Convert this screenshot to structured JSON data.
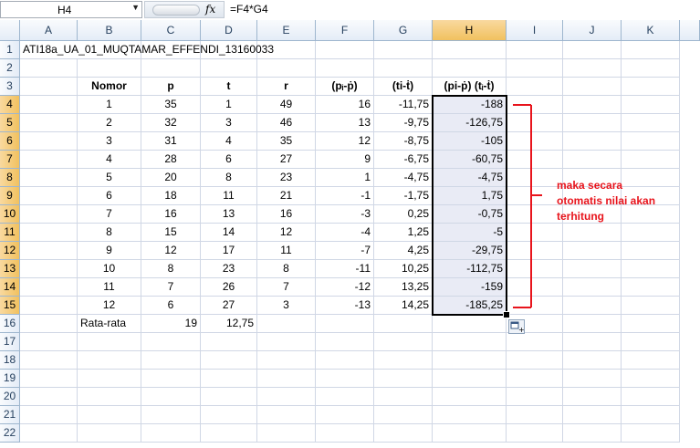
{
  "formula_bar": {
    "name_box": "H4",
    "fx_label": "fx",
    "formula": "=F4*G4"
  },
  "columns": [
    "A",
    "B",
    "C",
    "D",
    "E",
    "F",
    "G",
    "H",
    "I",
    "J",
    "K"
  ],
  "selected_column": "H",
  "rows": [
    "1",
    "2",
    "3",
    "4",
    "5",
    "6",
    "7",
    "8",
    "9",
    "10",
    "11",
    "12",
    "13",
    "14",
    "15",
    "16",
    "17",
    "18",
    "19",
    "20",
    "21",
    "22"
  ],
  "title": "ATI18a_UA_01_MUQTAMAR_EFFENDI_13160033",
  "headers": {
    "B": "Nomor",
    "C": "p",
    "D": "t",
    "E": "r",
    "F": "(pᵢ-ṗ)",
    "G": "(ti-ṫ)",
    "H": "(pi-ṗ) (tᵢ-ṫ)"
  },
  "table": [
    [
      "1",
      "35",
      "1",
      "49",
      "16",
      "-11,75",
      "-188"
    ],
    [
      "2",
      "32",
      "3",
      "46",
      "13",
      "-9,75",
      "-126,75"
    ],
    [
      "3",
      "31",
      "4",
      "35",
      "12",
      "-8,75",
      "-105"
    ],
    [
      "4",
      "28",
      "6",
      "27",
      "9",
      "-6,75",
      "-60,75"
    ],
    [
      "5",
      "20",
      "8",
      "23",
      "1",
      "-4,75",
      "-4,75"
    ],
    [
      "6",
      "18",
      "11",
      "21",
      "-1",
      "-1,75",
      "1,75"
    ],
    [
      "7",
      "16",
      "13",
      "16",
      "-3",
      "0,25",
      "-0,75"
    ],
    [
      "8",
      "15",
      "14",
      "12",
      "-4",
      "1,25",
      "-5"
    ],
    [
      "9",
      "12",
      "17",
      "11",
      "-7",
      "4,25",
      "-29,75"
    ],
    [
      "10",
      "8",
      "23",
      "8",
      "-11",
      "10,25",
      "-112,75"
    ],
    [
      "11",
      "7",
      "26",
      "7",
      "-12",
      "13,25",
      "-159"
    ],
    [
      "12",
      "6",
      "27",
      "3",
      "-13",
      "14,25",
      "-185,25"
    ]
  ],
  "average_row": {
    "label": "Rata-rata",
    "p_avg": "19",
    "t_avg": "12,75"
  },
  "annotation": {
    "text_lines": [
      "maka secara",
      "otomatis nilai akan",
      "terhitung"
    ],
    "color": "#e8141c"
  },
  "colors": {
    "header_bg": "#e4ecf7",
    "selected_header": "#f1c15f",
    "selection_fill": "#e9ebf5",
    "grid_line": "#d0d7e5"
  }
}
